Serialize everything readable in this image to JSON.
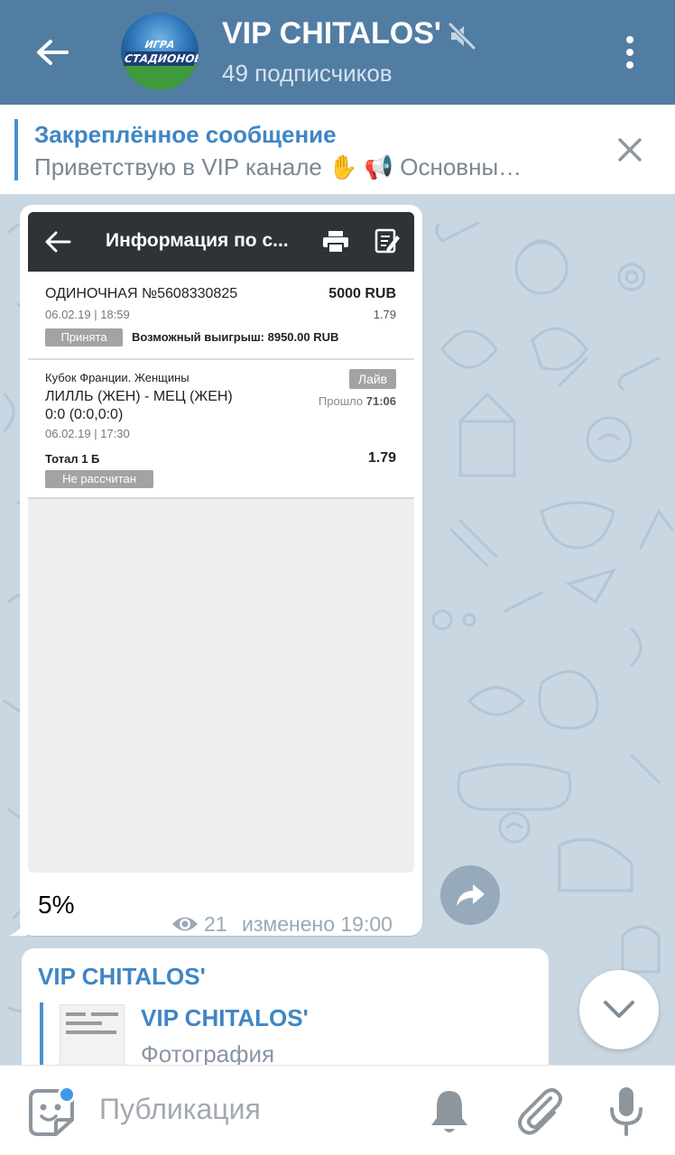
{
  "header": {
    "channel_title": "VIP CHITALOS'",
    "subscribers": "49 подписчиков",
    "avatar_text_line1": "ИГРА",
    "avatar_text_line2": "СТАДИОНОВ"
  },
  "pinned": {
    "title": "Закреплённое сообщение",
    "text": "Приветствую в VIP канале ✋ 📢 Основны…"
  },
  "message": {
    "screenshot": {
      "title": "Информация по с...",
      "bet_id": "ОДИНОЧНАЯ №5608330825",
      "amount": "5000 RUB",
      "date": "06.02.19 | 18:59",
      "odds": "1.79",
      "status": "Принята",
      "possible_win": "Возможный выигрыш: 8950.00 RUB",
      "tournament": "Кубок Франции. Женщины",
      "live_badge": "Лайв",
      "match": "ЛИЛЛЬ (ЖЕН) - МЕЦ (ЖЕН)",
      "elapsed_label": "Прошло",
      "elapsed": "71:06",
      "score": "0:0 (0:0,0:0)",
      "match_date": "06.02.19 | 17:30",
      "bet_type": "Тотал 1 Б",
      "bet_odds": "1.79",
      "settle_status": "Не рассчитан"
    },
    "caption": "5%",
    "views": "21",
    "edited": "изменено 19:00"
  },
  "message2": {
    "sender": "VIP CHITALOS'",
    "reply_title": "VIP CHITALOS'",
    "reply_subtitle": "Фотография"
  },
  "bottom": {
    "compose_placeholder": "Публикация"
  },
  "colors": {
    "header": "#527da3",
    "accent": "#3f86c4",
    "chat_bg": "#c9d7e3"
  },
  "icons": [
    "back-arrow-icon",
    "mute-icon",
    "more-vert-icon",
    "close-icon",
    "print-icon",
    "edit-icon",
    "eye-icon",
    "share-icon",
    "chevron-down-icon",
    "sticker-icon",
    "bell-icon",
    "paperclip-icon",
    "microphone-icon"
  ]
}
